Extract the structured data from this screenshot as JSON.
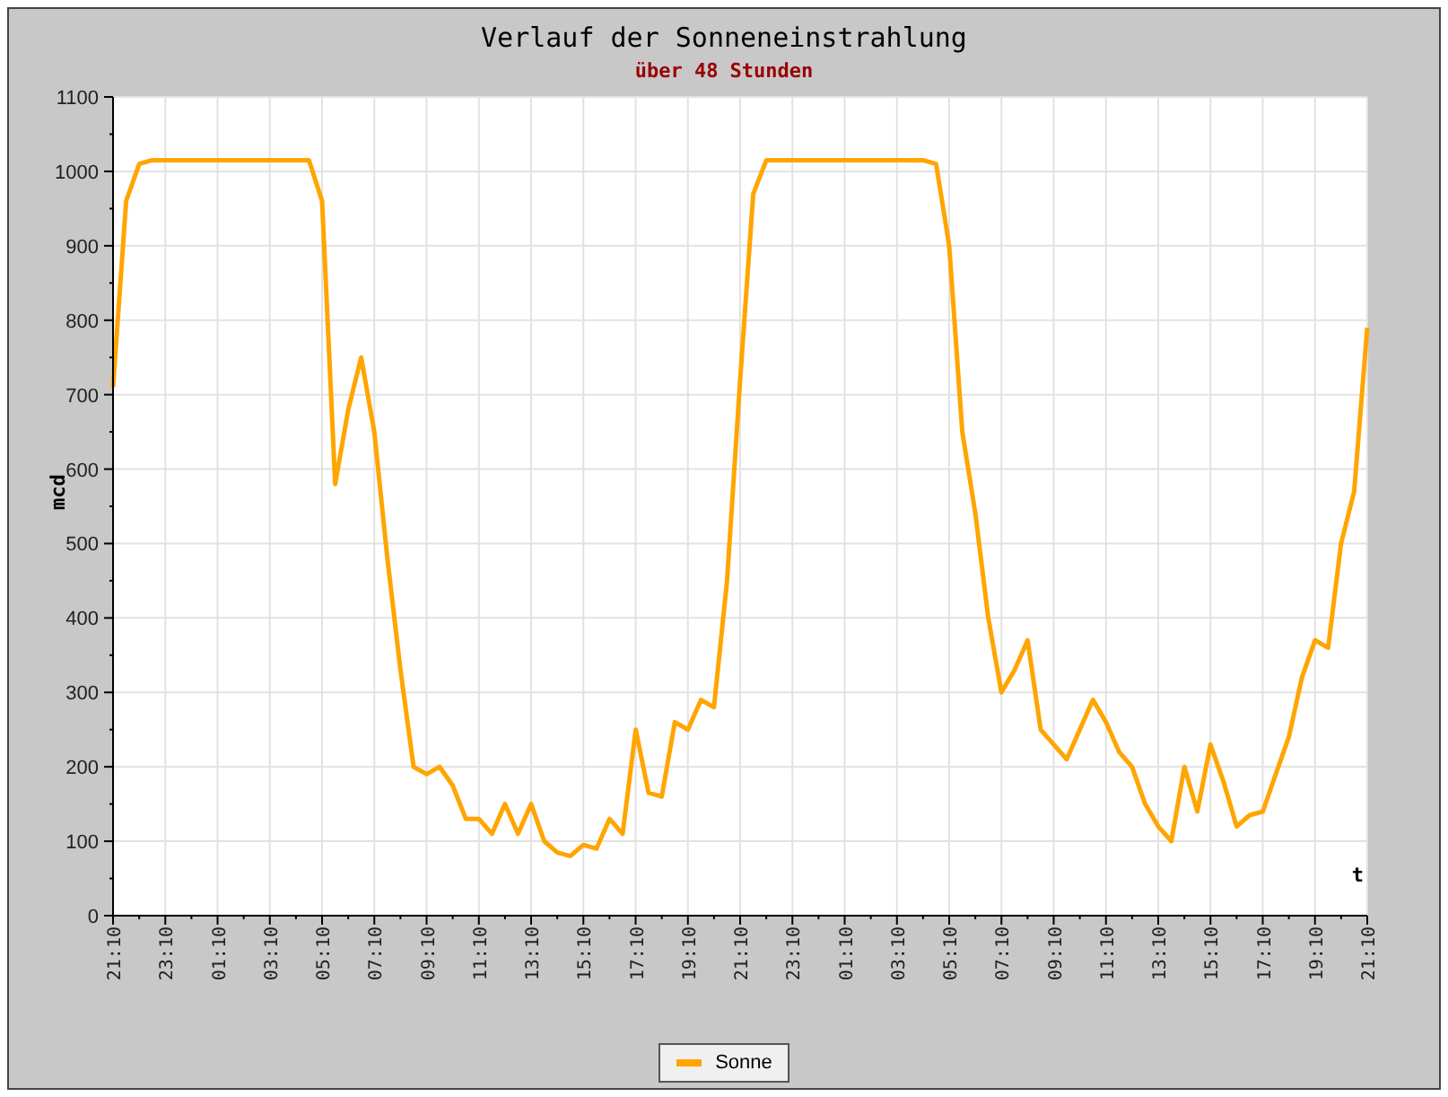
{
  "chart": {
    "subtitle": "über 48 Stunden",
    "chart_data": {
      "type": "line",
      "title": "Verlauf der Sonneneinstrahlung",
      "xlabel": "t",
      "ylabel": "mcd",
      "categories": [
        "21:10",
        null,
        null,
        null,
        "23:10",
        null,
        null,
        null,
        "01:10",
        null,
        null,
        null,
        "03:10",
        null,
        null,
        null,
        "05:10",
        null,
        null,
        null,
        "07:10",
        null,
        null,
        null,
        "09:10",
        null,
        null,
        null,
        "11:10",
        null,
        null,
        null,
        "13:10",
        null,
        null,
        null,
        "15:10",
        null,
        null,
        null,
        "17:10",
        null,
        null,
        null,
        "19:10",
        null,
        null,
        null,
        "21:10",
        null,
        null,
        null,
        "23:10",
        null,
        null,
        null,
        "01:10",
        null,
        null,
        null,
        "03:10",
        null,
        null,
        null,
        "05:10",
        null,
        null,
        null,
        "07:10",
        null,
        null,
        null,
        "09:10",
        null,
        null,
        null,
        "11:10",
        null,
        null,
        null,
        "13:10",
        null,
        null,
        null,
        "15:10",
        null,
        null,
        null,
        "17:10",
        null,
        null,
        null,
        "19:10",
        null,
        null,
        null,
        "21:10"
      ],
      "series": [
        {
          "name": "Sonne",
          "color": "#ffa500",
          "values": [
            710,
            960,
            1010,
            1015,
            1015,
            1015,
            1015,
            1015,
            1015,
            1015,
            1015,
            1015,
            1015,
            1015,
            1015,
            1015,
            960,
            580,
            680,
            750,
            650,
            480,
            330,
            200,
            190,
            200,
            175,
            130,
            130,
            110,
            150,
            110,
            150,
            100,
            85,
            80,
            95,
            90,
            130,
            110,
            250,
            165,
            160,
            260,
            250,
            290,
            280,
            450,
            720,
            970,
            1015,
            1015,
            1015,
            1015,
            1015,
            1015,
            1015,
            1015,
            1015,
            1015,
            1015,
            1015,
            1015,
            1010,
            900,
            650,
            540,
            400,
            300,
            330,
            370,
            250,
            230,
            210,
            250,
            290,
            260,
            220,
            200,
            150,
            120,
            100,
            200,
            140,
            230,
            180,
            120,
            135,
            140,
            190,
            240,
            320,
            370,
            360,
            500,
            570,
            790
          ]
        }
      ],
      "ylim": [
        0,
        1100
      ],
      "grid": true,
      "yticks": [
        0,
        100,
        200,
        300,
        400,
        500,
        600,
        700,
        800,
        900,
        1000,
        1100
      ]
    }
  }
}
